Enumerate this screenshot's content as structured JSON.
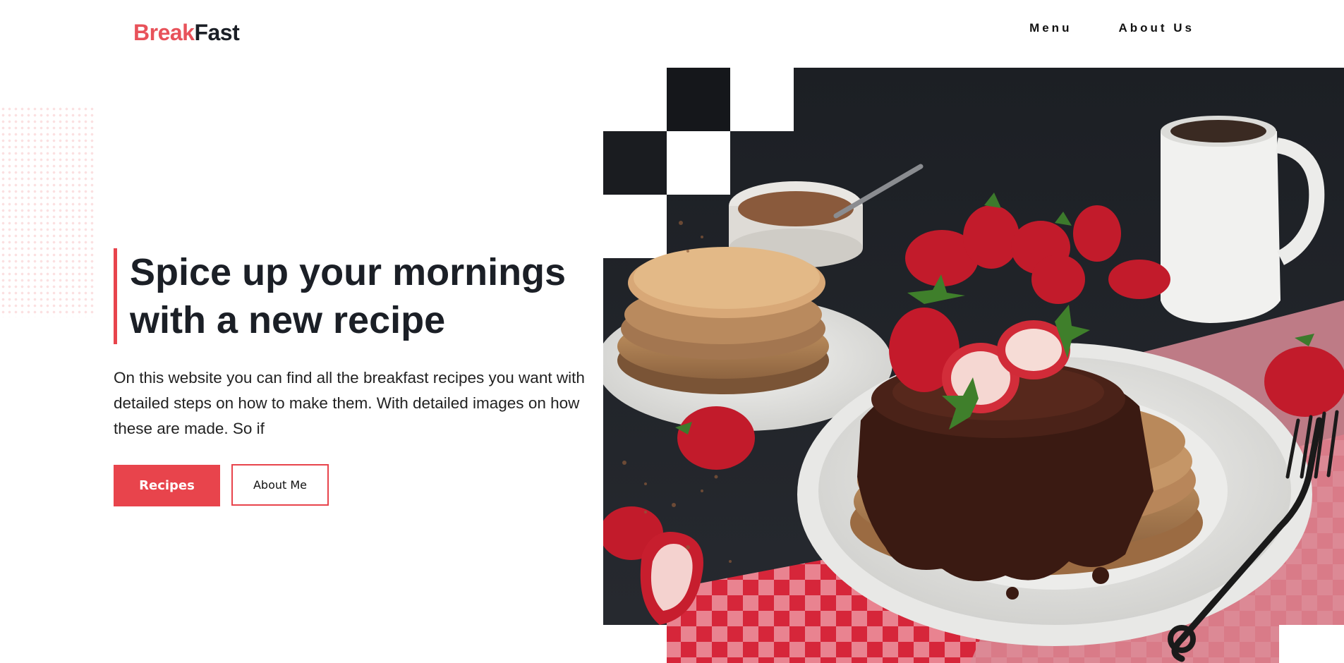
{
  "header": {
    "logo_part1": "Break",
    "logo_part2": "Fast",
    "nav": [
      "Menu",
      "About Us"
    ]
  },
  "hero": {
    "title_line1": "Spice up your mornings",
    "title_line2": "with a new recipe",
    "description": "On this website you can find all the breakfast recipes you want with detailed steps on how to make them. With detailed images on how these are made. So if",
    "primary_button": "Recipes",
    "secondary_button": "About Me"
  },
  "colors": {
    "accent": "#e8444c",
    "text": "#1b1f26"
  }
}
